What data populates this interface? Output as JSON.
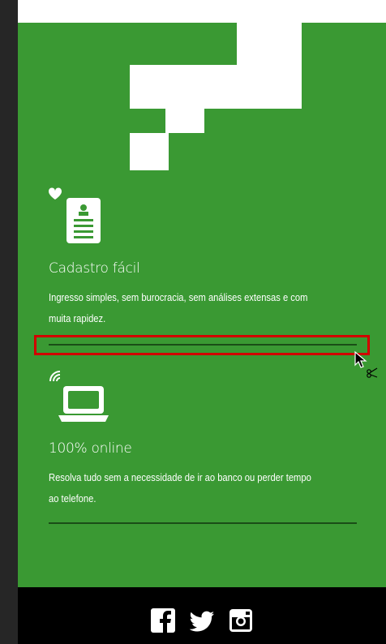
{
  "features": [
    {
      "icon": "document-heart-icon",
      "title": "Cadastro fácil",
      "description_line1": "Ingresso simples, sem burocracia, sem análises extensas e com",
      "description_line2": "muita rapidez."
    },
    {
      "icon": "laptop-wifi-icon",
      "title": "100% online",
      "description_line1": "Resolva tudo sem a necessidade de ir ao banco ou perder tempo",
      "description_line2": "ao telefone."
    }
  ],
  "footer": {
    "social": [
      "facebook-icon",
      "twitter-icon",
      "instagram-icon"
    ]
  },
  "colors": {
    "green": "#3a9933",
    "divider": "#1a4d17",
    "highlight": "#d20000",
    "footer": "#000000"
  }
}
